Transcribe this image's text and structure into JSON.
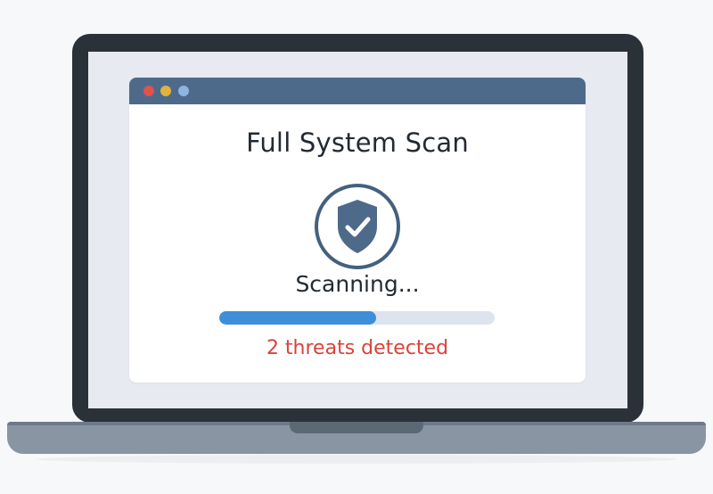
{
  "window": {
    "title": "Full System Scan",
    "controls": [
      "close-dot",
      "minimize-dot",
      "maximize-dot"
    ]
  },
  "scan": {
    "icon": "shield-check-icon",
    "status_text": "Scanning...",
    "progress_fraction": 0.57,
    "threats_text": "2 threats detected"
  },
  "colors": {
    "titlebar": "#4e6a8a",
    "accent": "#3d8fd9",
    "alert": "#d9433a",
    "close": "#e0524a",
    "minimize": "#e3b23c",
    "maximize": "#8fb4e0"
  }
}
